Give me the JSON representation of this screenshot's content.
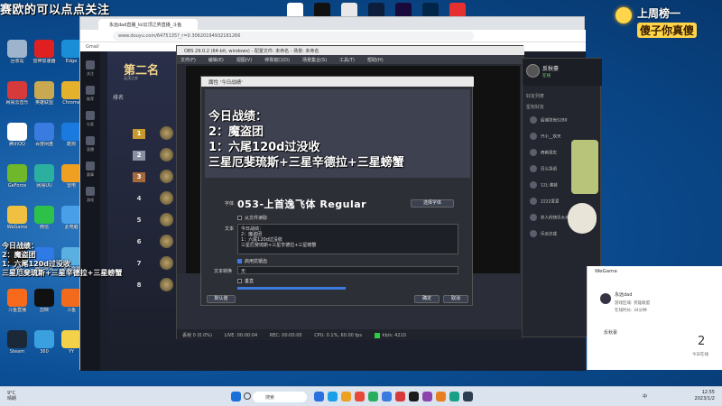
{
  "stream_banner": "赛欧的可以点点关注",
  "weekly_banner": {
    "line1": "上周榜一",
    "line2": "傻子你真傻"
  },
  "desktop_icons": [
    {
      "label": "回收站",
      "color": "#9db4cc"
    },
    {
      "label": "网易云音乐",
      "color": "#d63a3a"
    },
    {
      "label": "腾讯QQ",
      "color": "#ffffff"
    },
    {
      "label": "GeForce",
      "color": "#6fb82b"
    },
    {
      "label": "WeGame",
      "color": "#f0c040"
    },
    {
      "label": "OBS",
      "color": "#222"
    },
    {
      "label": "斗鱼直播",
      "color": "#f76a1c"
    },
    {
      "label": "Steam",
      "color": "#1b2838"
    },
    {
      "label": "雷神加速器",
      "color": "#e02020"
    },
    {
      "label": "英雄联盟",
      "color": "#c8a850"
    },
    {
      "label": "百度网盘",
      "color": "#3a7be0"
    },
    {
      "label": "网易UU",
      "color": "#2bb0a0"
    },
    {
      "label": "微信",
      "color": "#2ec14a"
    },
    {
      "label": "腾讯会议",
      "color": "#2f7ae5"
    },
    {
      "label": "剪映",
      "color": "#111"
    },
    {
      "label": "360",
      "color": "#3aa0e0"
    },
    {
      "label": "Edge",
      "color": "#1a8fd8"
    },
    {
      "label": "Chrome",
      "color": "#e4b12c"
    },
    {
      "label": "酷狗",
      "color": "#1a7ae0"
    },
    {
      "label": "雷电",
      "color": "#f0a020"
    },
    {
      "label": "此电脑",
      "color": "#4aa0e8"
    },
    {
      "label": "控制面板",
      "color": "#5ab0e0"
    },
    {
      "label": "斗鱼",
      "color": "#f26b1d"
    },
    {
      "label": "YY",
      "color": "#f3d24a"
    }
  ],
  "top_icons": [
    {
      "name": "cursor-icon",
      "color": "#fff"
    },
    {
      "name": "capcut-icon",
      "color": "#111"
    },
    {
      "name": "app-a-icon",
      "color": "#e8e8e8"
    },
    {
      "name": "photoshop-icon",
      "color": "#0c1e3c"
    },
    {
      "name": "premiere-icon",
      "color": "#1a0a3c"
    },
    {
      "name": "audition-icon",
      "color": "#00264a"
    },
    {
      "name": "app-red-icon",
      "color": "#e63030"
    }
  ],
  "browser": {
    "tab_title": "永远dad直播_lol云顶之弈直播_斗鱼",
    "url": "www.douyu.com/6475135?_r=0.30620194932181266",
    "bookmark": "Gmail"
  },
  "douyu": {
    "nav": [
      "关注",
      "推荐",
      "分类",
      "直播",
      "赛事",
      "游戏"
    ],
    "rank_title": "第二名",
    "rank_sub": "云顶之弈",
    "rank_header": "排名",
    "rank_rows": [
      "1",
      "2",
      "3",
      "4",
      "5",
      "6",
      "7",
      "8"
    ]
  },
  "obs": {
    "title": "OBS 29.0.2 (64-bit, windows) - 配置文件: 未命名 - 场景: 未命名",
    "menu": [
      "文件(F)",
      "编辑(E)",
      "视图(V)",
      "停靠窗口(D)",
      "场景集合(S)",
      "工具(T)",
      "帮助(H)"
    ],
    "status": {
      "dropped": "丢帧 0 (0.0%)",
      "live": "LIVE: 00:00:04",
      "rec": "REC: 00:00:00",
      "cpu": "CPU: 0.1%, 60.00 fps",
      "kbps": "kb/s: 4210"
    }
  },
  "dialog": {
    "title": "属性 '今日战绩'",
    "overlay_lines": [
      "今日战绩：",
      "2：魔盗团",
      "1：六尾120d过没收",
      "三星厄斐琉斯+三星辛德拉+三星螃蟹"
    ],
    "font_label": "字体",
    "font_name": "053-上首逸飞体 Regular",
    "font_button": "选择字体",
    "from_file_label": "从文件读取",
    "text_label": "文本",
    "text_value_lines": [
      "今日战绩：",
      "2：魔盗团",
      "1：六尾120d过没收",
      "三星厄斐琉斯+三星辛德拉+三星螃蟹"
    ],
    "antialias_label": "启用抗锯齿",
    "transform_label": "文本转换",
    "transform_value": "无",
    "vertical_label": "垂直",
    "default_button": "默认值",
    "ok_button": "确定",
    "cancel_button": "取消"
  },
  "chat": {
    "name": "反秋豪",
    "status": "在线",
    "section_friends": "好友列表",
    "section_fav": "星标好友",
    "items": [
      "后城坊尚5280",
      "只小__欢天",
      "奇艳现实",
      "日么哭语",
      "12L·满城",
      "2222爱爱",
      "命人的快乐大米",
      "乐云达成"
    ]
  },
  "wegame": {
    "title": "WeGame",
    "user": "永远dad",
    "info1": "游戏区域: 英雄联盟",
    "info2": "在线时长: 34分钟",
    "friend": "反秋豪",
    "count": "2",
    "count_label": "今日在线"
  },
  "taskbar": {
    "weather_temp": "9°C",
    "weather_desc": "晴朗",
    "search": "搜索",
    "lang": "中",
    "time": "12:55",
    "date": "2023/1/2"
  },
  "left_overlay_lines": [
    "今日战绩：",
    "2：魔盗团",
    "1：六尾120d过没收",
    "三星厄斐琉斯+三星辛德拉+三星螃蟹"
  ]
}
